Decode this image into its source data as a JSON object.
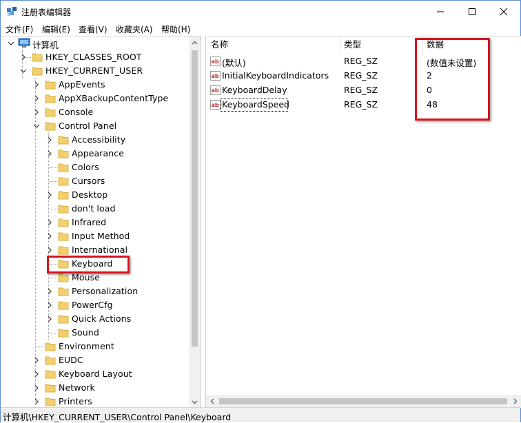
{
  "window": {
    "title": "注册表编辑器"
  },
  "menu": [
    "文件(F)",
    "编辑(E)",
    "查看(V)",
    "收藏夹(A)",
    "帮助(H)"
  ],
  "tree": {
    "root": "计算机",
    "hkcr": "HKEY_CLASSES_ROOT",
    "hkcu": "HKEY_CURRENT_USER",
    "hkcu_children": [
      {
        "label": "AppEvents",
        "expandable": true
      },
      {
        "label": "AppXBackupContentType",
        "expandable": true
      },
      {
        "label": "Console",
        "expandable": true
      },
      {
        "label": "Control Panel",
        "expanded": true
      },
      {
        "label": "Environment",
        "expandable": false
      },
      {
        "label": "EUDC",
        "expandable": true
      },
      {
        "label": "Keyboard Layout",
        "expandable": true
      },
      {
        "label": "Network",
        "expandable": true
      },
      {
        "label": "Printers",
        "expandable": true
      }
    ],
    "control_panel_children": [
      {
        "label": "Accessibility",
        "expandable": true
      },
      {
        "label": "Appearance",
        "expandable": true
      },
      {
        "label": "Colors",
        "expandable": false
      },
      {
        "label": "Cursors",
        "expandable": false
      },
      {
        "label": "Desktop",
        "expandable": true
      },
      {
        "label": "don't load",
        "expandable": false
      },
      {
        "label": "Infrared",
        "expandable": true
      },
      {
        "label": "Input Method",
        "expandable": true
      },
      {
        "label": "International",
        "expandable": true
      },
      {
        "label": "Keyboard",
        "expandable": false,
        "selected": true
      },
      {
        "label": "Mouse",
        "expandable": false
      },
      {
        "label": "Personalization",
        "expandable": true
      },
      {
        "label": "PowerCfg",
        "expandable": true
      },
      {
        "label": "Quick Actions",
        "expandable": true
      },
      {
        "label": "Sound",
        "expandable": false
      }
    ]
  },
  "values": {
    "headers": {
      "name": "名称",
      "type": "类型",
      "data": "数据"
    },
    "rows": [
      {
        "name": "(默认)",
        "type": "REG_SZ",
        "data": "(数值未设置)"
      },
      {
        "name": "InitialKeyboardIndicators",
        "type": "REG_SZ",
        "data": "2"
      },
      {
        "name": "KeyboardDelay",
        "type": "REG_SZ",
        "data": "0"
      },
      {
        "name": "KeyboardSpeed",
        "type": "REG_SZ",
        "data": "48"
      }
    ]
  },
  "icons": {
    "app": "regedit-icon",
    "computer": "computer-icon",
    "folder": "folder-icon",
    "string_value": "string-value-icon",
    "folder_color": "#f2d070",
    "highlight_color": "#d4141b"
  },
  "status": {
    "path": "计算机\\HKEY_CURRENT_USER\\Control Panel\\Keyboard"
  }
}
